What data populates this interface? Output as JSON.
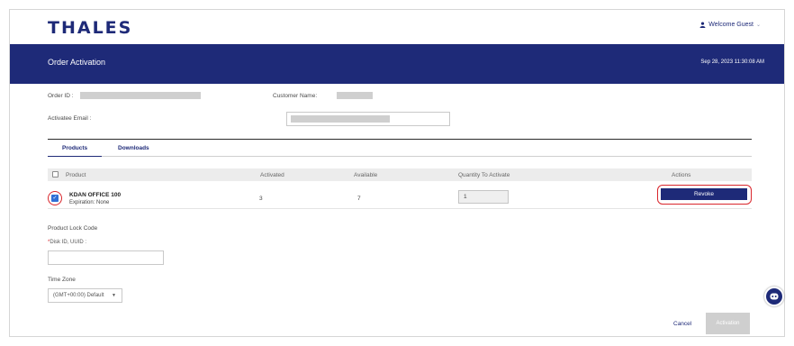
{
  "header": {
    "logo": "THALES",
    "user_menu": "Welcome Guest",
    "page_title": "Order Activation",
    "datetime": "Sep 28, 2023 11:30:08 AM"
  },
  "order": {
    "order_id_label": "Order ID :",
    "customer_name_label": "Customer Name:",
    "activatee_email_label": "Activatee Email :"
  },
  "tabs": [
    "Products",
    "Downloads"
  ],
  "table": {
    "columns": [
      "Product",
      "Activated",
      "Available",
      "Quantity To Activate",
      "Actions"
    ],
    "rows": [
      {
        "product": "KDAN OFFICE 100",
        "expiration": "Expiration: None",
        "activated": "3",
        "available": "7",
        "quantity": "1",
        "action": "Revoke"
      }
    ]
  },
  "lock": {
    "section_label": "Product Lock Code",
    "disk_label": "Disk ID, UUID :",
    "timezone_label": "Time Zone",
    "timezone_value": "(GMT+00:00) Default"
  },
  "footer": {
    "cancel": "Cancel",
    "activation": "Activation"
  },
  "colors": {
    "brand_navy": "#1e2a78",
    "highlight_red": "#d9262c",
    "checkbox_blue": "#2f6fd6"
  }
}
